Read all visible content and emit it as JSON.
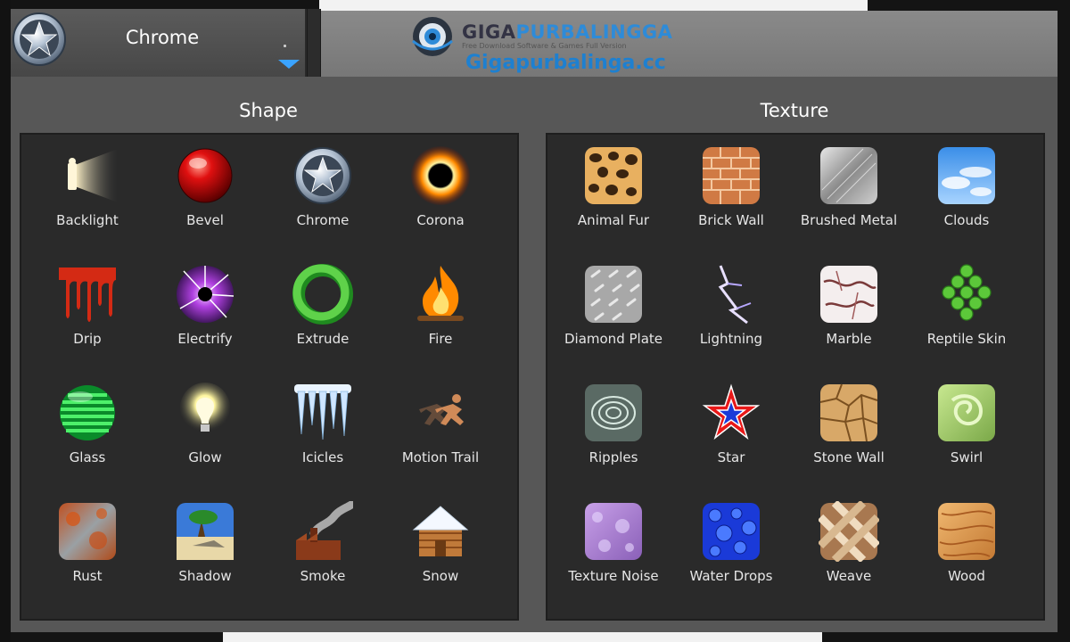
{
  "header": {
    "selected_effect": "Chrome",
    "selected_icon": "chrome-star-icon"
  },
  "watermark": {
    "brand_part1": "GIGA",
    "brand_part2": "PURBALINGGA",
    "tagline": "Free Download Software & Games Full Version",
    "site": "Gigapurbalinga.cc"
  },
  "shape": {
    "title": "Shape",
    "items": [
      {
        "label": "Backlight",
        "icon": "backlight-icon"
      },
      {
        "label": "Bevel",
        "icon": "bevel-icon"
      },
      {
        "label": "Chrome",
        "icon": "chrome-icon"
      },
      {
        "label": "Corona",
        "icon": "corona-icon"
      },
      {
        "label": "Drip",
        "icon": "drip-icon"
      },
      {
        "label": "Electrify",
        "icon": "electrify-icon"
      },
      {
        "label": "Extrude",
        "icon": "extrude-icon"
      },
      {
        "label": "Fire",
        "icon": "fire-icon"
      },
      {
        "label": "Glass",
        "icon": "glass-icon"
      },
      {
        "label": "Glow",
        "icon": "glow-icon"
      },
      {
        "label": "Icicles",
        "icon": "icicles-icon"
      },
      {
        "label": "Motion Trail",
        "icon": "motion-trail-icon"
      },
      {
        "label": "Rust",
        "icon": "rust-icon"
      },
      {
        "label": "Shadow",
        "icon": "shadow-icon"
      },
      {
        "label": "Smoke",
        "icon": "smoke-icon"
      },
      {
        "label": "Snow",
        "icon": "snow-icon"
      }
    ]
  },
  "texture": {
    "title": "Texture",
    "items": [
      {
        "label": "Animal Fur",
        "icon": "animal-fur-icon"
      },
      {
        "label": "Brick Wall",
        "icon": "brick-wall-icon"
      },
      {
        "label": "Brushed Metal",
        "icon": "brushed-metal-icon"
      },
      {
        "label": "Clouds",
        "icon": "clouds-icon"
      },
      {
        "label": "Diamond Plate",
        "icon": "diamond-plate-icon"
      },
      {
        "label": "Lightning",
        "icon": "lightning-icon"
      },
      {
        "label": "Marble",
        "icon": "marble-icon"
      },
      {
        "label": "Reptile Skin",
        "icon": "reptile-skin-icon"
      },
      {
        "label": "Ripples",
        "icon": "ripples-icon"
      },
      {
        "label": "Star",
        "icon": "star-icon"
      },
      {
        "label": "Stone Wall",
        "icon": "stone-wall-icon"
      },
      {
        "label": "Swirl",
        "icon": "swirl-icon"
      },
      {
        "label": "Texture Noise",
        "icon": "texture-noise-icon"
      },
      {
        "label": "Water Drops",
        "icon": "water-drops-icon"
      },
      {
        "label": "Weave",
        "icon": "weave-icon"
      },
      {
        "label": "Wood",
        "icon": "wood-icon"
      }
    ]
  },
  "colors": {
    "accent": "#3aa3ff",
    "panel_bg": "#2a2a2a",
    "frame_bg": "#575757"
  }
}
